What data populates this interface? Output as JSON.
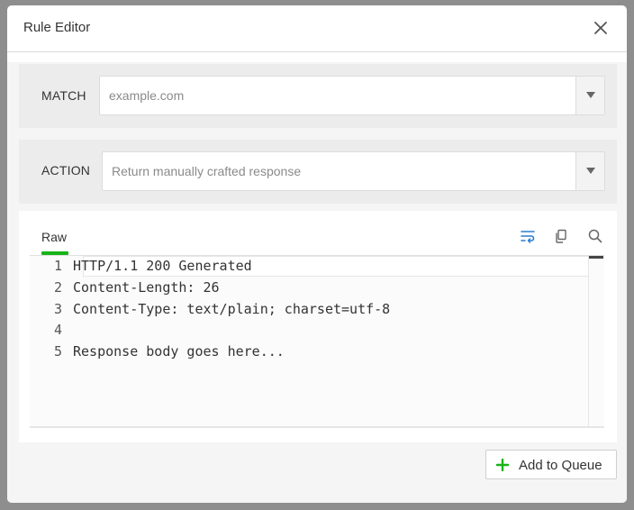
{
  "dialog": {
    "title": "Rule Editor"
  },
  "match": {
    "label": "MATCH",
    "value": "example.com"
  },
  "action": {
    "label": "ACTION",
    "value": "Return manually crafted response"
  },
  "editor": {
    "tab_label": "Raw",
    "lines": [
      {
        "number": "1",
        "text": "HTTP/1.1 200 Generated"
      },
      {
        "number": "2",
        "text": "Content-Length: 26"
      },
      {
        "number": "3",
        "text": "Content-Type: text/plain; charset=utf-8"
      },
      {
        "number": "4",
        "text": ""
      },
      {
        "number": "5",
        "text": "Response body goes here..."
      }
    ]
  },
  "footer": {
    "add_label": "Add to Queue"
  },
  "icons": {
    "close": "close-icon",
    "dropdown": "chevron-down-icon",
    "wrap": "word-wrap-icon",
    "copy": "copy-icon",
    "search": "search-icon",
    "add": "plus-icon"
  },
  "colors": {
    "accent_green": "#17b417",
    "wrap_icon_blue": "#2b7bd4"
  }
}
